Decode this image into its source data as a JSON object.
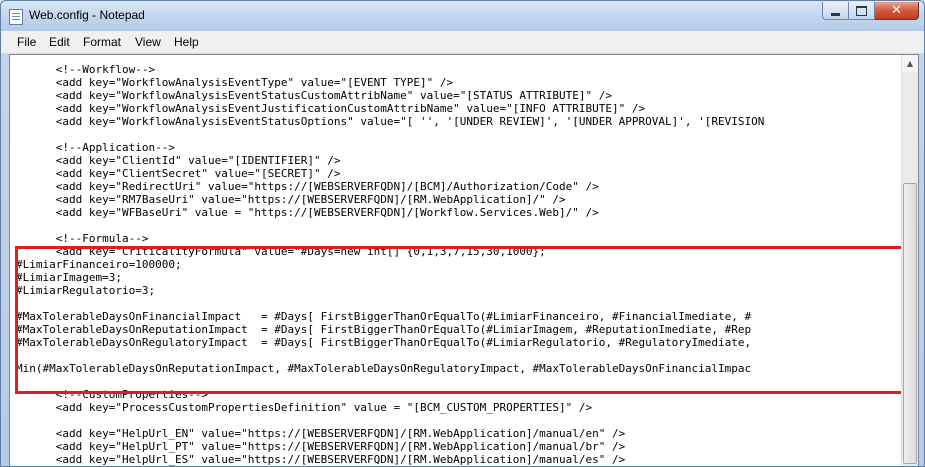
{
  "window": {
    "title": "Web.config - Notepad",
    "close_glyph": "✕",
    "icons": [
      "notepad-icon",
      "minimize-icon",
      "maximize-icon",
      "close-icon"
    ]
  },
  "menu": [
    "File",
    "Edit",
    "Format",
    "View",
    "Help"
  ],
  "editor": {
    "lines": [
      "      <!--Workflow-->",
      "      <add key=\"WorkflowAnalysisEventType\" value=\"[EVENT TYPE]\" />",
      "      <add key=\"WorkflowAnalysisEventStatusCustomAttribName\" value=\"[STATUS ATTRIBUTE]\" />",
      "      <add key=\"WorkflowAnalysisEventJustificationCustomAttribName\" value=\"[INFO ATTRIBUTE]\" />",
      "      <add key=\"WorkflowAnalysisEventStatusOptions\" value=\"[ '', '[UNDER REVIEW]', '[UNDER APPROVAL]', '[REVISION",
      "",
      "      <!--Application-->",
      "      <add key=\"ClientId\" value=\"[IDENTIFIER]\" />",
      "      <add key=\"ClientSecret\" value=\"[SECRET]\" />",
      "      <add key=\"RedirectUri\" value=\"https://[WEBSERVERFQDN]/[BCM]/Authorization/Code\" />",
      "      <add key=\"RM7BaseUri\" value=\"https://[WEBSERVERFQDN]/[RM.WebApplication]/\" />",
      "      <add key=\"WFBaseUri\" value = \"https://[WEBSERVERFQDN]/[Workflow.Services.Web]/\" />",
      "",
      "      <!--Formula-->",
      "      <add key=\"CriticalityFormula\" value=\"#Days=new int[] {0,1,3,7,15,30,1000};",
      "#LimiarFinanceiro=100000;",
      "#LimiarImagem=3;",
      "#LimiarRegulatorio=3;",
      "",
      "#MaxTolerableDaysOnFinancialImpact   = #Days[ FirstBiggerThanOrEqualTo(#LimiarFinanceiro, #FinancialImediate, #",
      "#MaxTolerableDaysOnReputationImpact  = #Days[ FirstBiggerThanOrEqualTo(#LimiarImagem, #ReputationImediate, #Rep",
      "#MaxTolerableDaysOnRegulatoryImpact  = #Days[ FirstBiggerThanOrEqualTo(#LimiarRegulatorio, #RegulatoryImediate,",
      "",
      "Min(#MaxTolerableDaysOnReputationImpact, #MaxTolerableDaysOnRegulatoryImpact, #MaxTolerableDaysOnFinancialImpac",
      "",
      "      <!--CustomProperties-->",
      "      <add key=\"ProcessCustomPropertiesDefinition\" value = \"[BCM_CUSTOM_PROPERTIES]\" />",
      "",
      "      <add key=\"HelpUrl_EN\" value=\"https://[WEBSERVERFQDN]/[RM.WebApplication]/manual/en\" />",
      "      <add key=\"HelpUrl_PT\" value=\"https://[WEBSERVERFQDN]/[RM.WebApplication]/manual/br\" />",
      "      <add key=\"HelpUrl_ES\" value=\"https://[WEBSERVERFQDN]/[RM.WebApplication]/manual/es\" />"
    ]
  },
  "scrollbar": {
    "up_glyph": "▲",
    "position": 0.41
  },
  "highlight": {
    "color": "#e01e1e"
  }
}
